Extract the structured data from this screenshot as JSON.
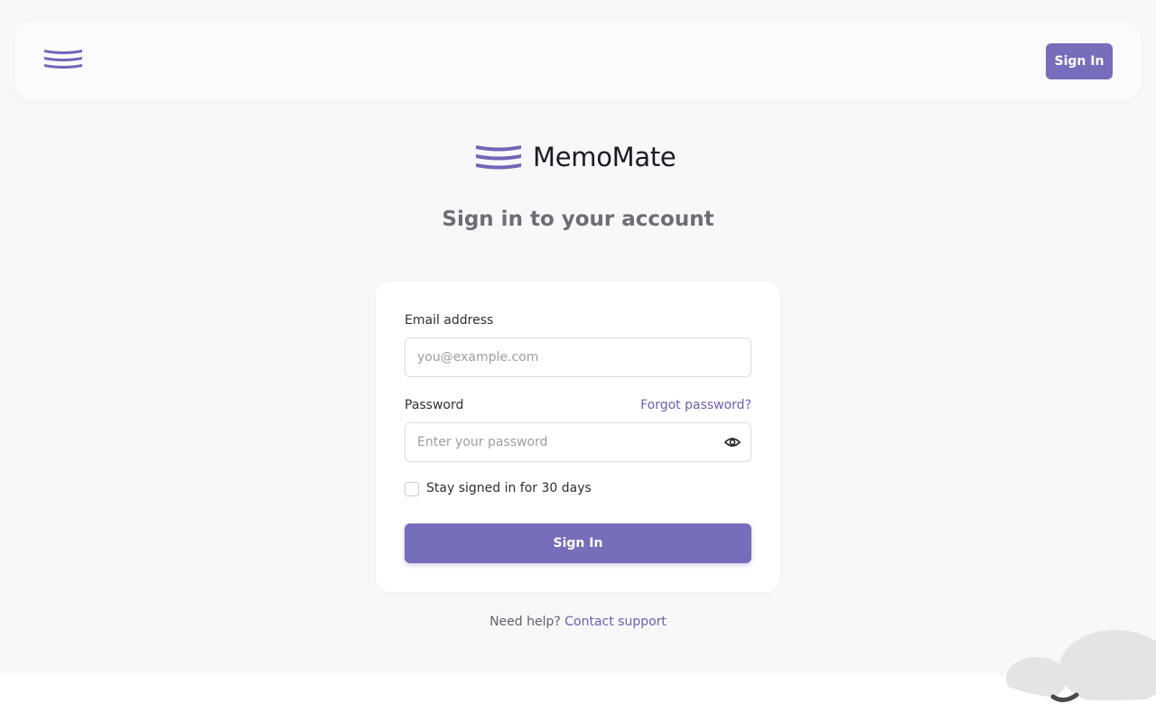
{
  "app": {
    "name": "MemoMate"
  },
  "header": {
    "sign_in_label": "Sign In",
    "logo_icon": "stacked-wave-logo-icon"
  },
  "main": {
    "heading": "Sign in to your account"
  },
  "form": {
    "email_label": "Email address",
    "email_placeholder": "you@example.com",
    "email_value": "",
    "password_label": "Password",
    "forgot_link": "Forgot password?",
    "password_placeholder": "Enter your password",
    "password_value": "",
    "show_password_icon": "eye-icon",
    "remember_label": "Stay signed in for 30 days",
    "remember_checked": false,
    "submit_label": "Sign In"
  },
  "footer": {
    "help_text": "Need help?",
    "support_link": "Contact support"
  },
  "colors": {
    "accent": "#766dbb",
    "link": "#6a60b3",
    "background": "#f7f8fa"
  }
}
